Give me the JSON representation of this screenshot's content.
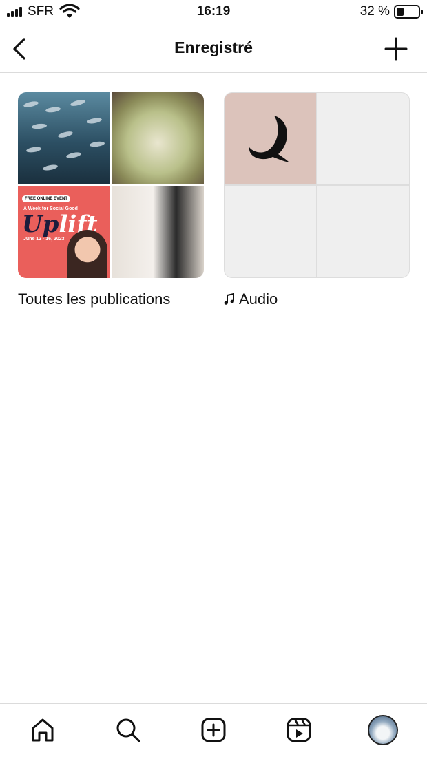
{
  "status_bar": {
    "carrier": "SFR",
    "time": "16:19",
    "battery_percent": "32 %",
    "battery_level": 0.32
  },
  "header": {
    "title": "Enregistré",
    "back_icon": "chevron-left-icon",
    "add_icon": "plus-icon"
  },
  "collections": [
    {
      "label": "Toutes les publications",
      "tiles": [
        "fish-school-photo",
        "pasta-dish-photo",
        "uplift-event-poster",
        "woman-black-dress-photo"
      ],
      "poster": {
        "badge": "FREE ONLINE EVENT",
        "subtitle": "A Week for Social Good",
        "word_up": "Up",
        "word_lift": "lift",
        "dates": "June 12 - 16, 2023"
      }
    },
    {
      "label": "Audio",
      "icon": "music-note-icon",
      "tiles": [
        "moon-logo",
        "empty",
        "empty",
        "empty"
      ]
    }
  ],
  "tab_bar": {
    "items": [
      "home-icon",
      "search-icon",
      "create-icon",
      "reels-icon",
      "profile-avatar"
    ]
  },
  "colors": {
    "divider": "#dbdbdb",
    "empty_tile": "#efefef",
    "poster_red": "#ea5f5b",
    "logo_tile": "#dcc3bb"
  }
}
